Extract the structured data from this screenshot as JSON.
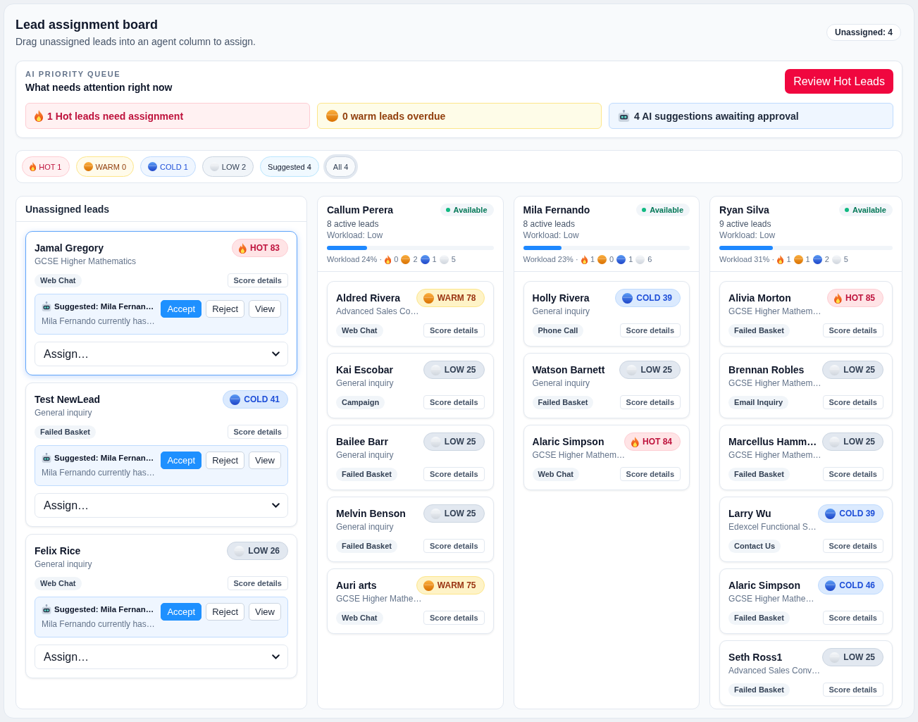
{
  "header": {
    "title": "Lead assignment board",
    "subtitle": "Drag unassigned leads into an agent column to assign.",
    "unassigned_count": "Unassigned: 4"
  },
  "priority_queue": {
    "eyebrow": "AI PRIORITY QUEUE",
    "title": "What needs attention right now",
    "action": "Review Hot Leads",
    "alerts": [
      {
        "kind": "hot",
        "text": "1 Hot leads need assignment"
      },
      {
        "kind": "warm",
        "text": "0 warm leads overdue"
      },
      {
        "kind": "ai",
        "text": "4 AI suggestions awaiting approval"
      }
    ]
  },
  "filters": [
    {
      "kind": "hot",
      "label": "HOT 1",
      "selected": false
    },
    {
      "kind": "warm",
      "label": "WARM 0",
      "selected": false
    },
    {
      "kind": "cold",
      "label": "COLD 1",
      "selected": false
    },
    {
      "kind": "low",
      "label": "LOW 2",
      "selected": false
    },
    {
      "kind": "suggested",
      "label": "Suggested 4",
      "selected": false
    },
    {
      "kind": "all",
      "label": "All 4",
      "selected": true
    }
  ],
  "unassigned": {
    "title": "Unassigned leads",
    "leads": [
      {
        "name": "Jamal Gregory",
        "course": "GCSE Higher Mathematics",
        "temperature": {
          "kind": "hot",
          "label": "HOT 83"
        },
        "source": "Web Chat",
        "score_label": "Score details",
        "selected": true,
        "suggestion": {
          "title": "Suggested: Mila Fernan…",
          "detail": "Mila Fernando currently has…",
          "actions": [
            {
              "kind": "primary",
              "label": "Accept"
            },
            {
              "kind": "secondary",
              "label": "Reject"
            },
            {
              "kind": "secondary",
              "label": "View"
            }
          ]
        },
        "assign": "Assign…"
      },
      {
        "name": "Test NewLead",
        "course": "General inquiry",
        "temperature": {
          "kind": "cold",
          "label": "COLD 41"
        },
        "source": "Failed Basket",
        "score_label": "Score details",
        "selected": false,
        "suggestion": {
          "title": "Suggested: Mila Fernan…",
          "detail": "Mila Fernando currently has…",
          "actions": [
            {
              "kind": "primary",
              "label": "Accept"
            },
            {
              "kind": "secondary",
              "label": "Reject"
            },
            {
              "kind": "secondary",
              "label": "View"
            }
          ]
        },
        "assign": "Assign…"
      },
      {
        "name": "Felix Rice",
        "course": "General inquiry",
        "temperature": {
          "kind": "low",
          "label": "LOW 26"
        },
        "source": "Web Chat",
        "score_label": "Score details",
        "selected": false,
        "suggestion": {
          "title": "Suggested: Mila Fernan…",
          "detail": "Mila Fernando currently has…",
          "actions": [
            {
              "kind": "primary",
              "label": "Accept"
            },
            {
              "kind": "secondary",
              "label": "Reject"
            },
            {
              "kind": "secondary",
              "label": "View"
            }
          ]
        },
        "assign": "Assign…"
      }
    ]
  },
  "agents": [
    {
      "name": "Callum Perera",
      "status": {
        "kind": "available",
        "label": "Available"
      },
      "active": "8 active leads",
      "workload": "Workload: Low",
      "level": 0.24,
      "summary": "Workload 24% ·",
      "counts": [
        {
          "kind": "hot",
          "count": "0"
        },
        {
          "kind": "warm",
          "count": "2"
        },
        {
          "kind": "cold",
          "count": "1"
        },
        {
          "kind": "low",
          "count": "5"
        }
      ],
      "leads": [
        {
          "name": "Aldred Rivera",
          "course": "Advanced Sales Co…",
          "temperature": {
            "kind": "warm",
            "label": "WARM 78"
          },
          "source": "Web Chat",
          "score_label": "Score details"
        },
        {
          "name": "Kai Escobar",
          "course": "General inquiry",
          "temperature": {
            "kind": "low",
            "label": "LOW 25"
          },
          "source": "Campaign",
          "score_label": "Score details"
        },
        {
          "name": "Bailee Barr",
          "course": "General inquiry",
          "temperature": {
            "kind": "low",
            "label": "LOW 25"
          },
          "source": "Failed Basket",
          "score_label": "Score details"
        },
        {
          "name": "Melvin Benson",
          "course": "General inquiry",
          "temperature": {
            "kind": "low",
            "label": "LOW 25"
          },
          "source": "Failed Basket",
          "score_label": "Score details"
        },
        {
          "name": "Auri arts",
          "course": "GCSE Higher Mathe…",
          "temperature": {
            "kind": "warm",
            "label": "WARM 75"
          },
          "source": "Web Chat",
          "score_label": "Score details"
        }
      ]
    },
    {
      "name": "Mila Fernando",
      "status": {
        "kind": "available",
        "label": "Available"
      },
      "active": "8 active leads",
      "workload": "Workload: Low",
      "level": 0.23,
      "summary": "Workload 23% ·",
      "counts": [
        {
          "kind": "hot",
          "count": "1"
        },
        {
          "kind": "warm",
          "count": "0"
        },
        {
          "kind": "cold",
          "count": "1"
        },
        {
          "kind": "low",
          "count": "6"
        }
      ],
      "leads": [
        {
          "name": "Holly Rivera",
          "course": "General inquiry",
          "temperature": {
            "kind": "cold",
            "label": "COLD 39"
          },
          "source": "Phone Call",
          "score_label": "Score details"
        },
        {
          "name": "Watson Barnett",
          "course": "General inquiry",
          "temperature": {
            "kind": "low",
            "label": "LOW 25"
          },
          "source": "Failed Basket",
          "score_label": "Score details"
        },
        {
          "name": "Alaric Simpson",
          "course": "GCSE Higher Mathem…",
          "temperature": {
            "kind": "hot",
            "label": "HOT 84"
          },
          "source": "Web Chat",
          "score_label": "Score details"
        }
      ]
    },
    {
      "name": "Ryan Silva",
      "status": {
        "kind": "available",
        "label": "Available"
      },
      "active": "9 active leads",
      "workload": "Workload: Low",
      "level": 0.31,
      "summary": "Workload 31% ·",
      "counts": [
        {
          "kind": "hot",
          "count": "1"
        },
        {
          "kind": "warm",
          "count": "1"
        },
        {
          "kind": "cold",
          "count": "2"
        },
        {
          "kind": "low",
          "count": "5"
        }
      ],
      "leads": [
        {
          "name": "Alivia Morton",
          "course": "GCSE Higher Mathem…",
          "temperature": {
            "kind": "hot",
            "label": "HOT 85"
          },
          "source": "Failed Basket",
          "score_label": "Score details"
        },
        {
          "name": "Brennan Robles",
          "course": "GCSE Higher Mathem…",
          "temperature": {
            "kind": "low",
            "label": "LOW 25"
          },
          "source": "Email Inquiry",
          "score_label": "Score details"
        },
        {
          "name": "Marcellus Hamm…",
          "course": "GCSE Higher Mathem…",
          "temperature": {
            "kind": "low",
            "label": "LOW 25"
          },
          "source": "Failed Basket",
          "score_label": "Score details"
        },
        {
          "name": "Larry Wu",
          "course": "Edexcel Functional S…",
          "temperature": {
            "kind": "cold",
            "label": "COLD 39"
          },
          "source": "Contact Us",
          "score_label": "Score details"
        },
        {
          "name": "Alaric Simpson",
          "course": "GCSE Higher Mathe…",
          "temperature": {
            "kind": "cold",
            "label": "COLD 46"
          },
          "source": "Failed Basket",
          "score_label": "Score details"
        },
        {
          "name": "Seth Ross1",
          "course": "Advanced Sales Conv…",
          "temperature": {
            "kind": "low",
            "label": "LOW 25"
          },
          "source": "Failed Basket",
          "score_label": "Score details"
        }
      ]
    }
  ]
}
